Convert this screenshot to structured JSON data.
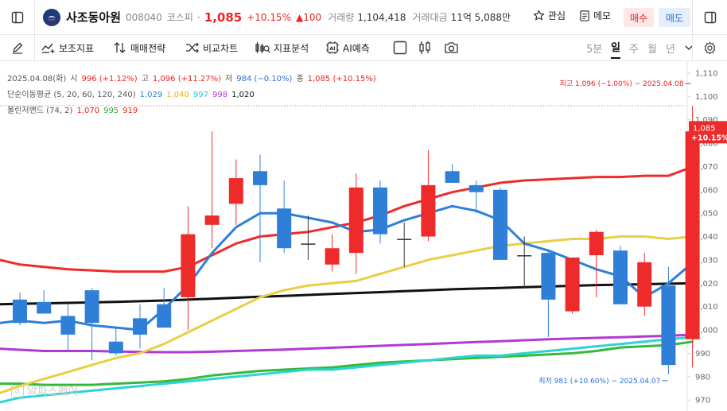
{
  "header": {
    "stock_name": "사조동아원",
    "stock_code": "008040",
    "market": "코스피",
    "price": "1,085",
    "change_pct": "+10.15%",
    "change_abs": "▲100",
    "volume_label": "거래량",
    "volume_value": "1,104,418",
    "amount_label": "거래대금",
    "amount_value": "11억 5,088만",
    "watch_label": "관심",
    "memo_label": "메모",
    "buy_label": "매수",
    "sell_label": "매도"
  },
  "toolbar": {
    "indicators_label": "보조지표",
    "strategy_label": "매매전략",
    "compare_label": "비교차트",
    "analysis_label": "지표분석",
    "ai_label": "AI예측",
    "periods": [
      "5분",
      "일",
      "주",
      "월",
      "년"
    ],
    "active_period": "일"
  },
  "info": {
    "date": "2025.04.08(화)",
    "open_label": "시",
    "open_value": "996 (+1.12%)",
    "high_label": "고",
    "high_value": "1,096 (+11.27%)",
    "low_label": "저",
    "low_value": "984 (−0.10%)",
    "close_label": "종",
    "close_value": "1,085 (+10.15%)",
    "ma_label": "단순이동평균 (5, 20, 60, 120, 240)",
    "ma_values": [
      "1,029",
      "1,040",
      "997",
      "998",
      "1,020"
    ],
    "bb_label": "볼린저밴드 (74, 2)",
    "bb_values": [
      "1,070",
      "995",
      "919"
    ]
  },
  "colors": {
    "up": "#ee2b2b",
    "down": "#2f7fd8",
    "ma5": "#2f7fd8",
    "ma20": "#e8cf45",
    "ma60": "#2ed3d8",
    "ma120": "#b03ad6",
    "ma240": "#111111",
    "bb_upper": "#ee2b2b",
    "bb_mid": "#36b83a"
  },
  "watermark": "알파스퀘어",
  "chart_data": {
    "type": "candlestick",
    "ylim": [
      967,
      1112
    ],
    "yticks": [
      970,
      980,
      990,
      1000,
      1010,
      1020,
      1030,
      1040,
      1050,
      1060,
      1070,
      1080,
      1090,
      1100,
      1110
    ],
    "price_badge": [
      "1,085",
      "+10.15%"
    ],
    "candles": [
      {
        "o": 1013,
        "h": 1016,
        "l": 1002,
        "c": 1003
      },
      {
        "o": 1012,
        "h": 1017,
        "l": 1007,
        "c": 1007
      },
      {
        "o": 1006,
        "h": 1011,
        "l": 991,
        "c": 998
      },
      {
        "o": 1017,
        "h": 1018,
        "l": 987,
        "c": 1003
      },
      {
        "o": 995,
        "h": 1001,
        "l": 989,
        "c": 990
      },
      {
        "o": 1005,
        "h": 1011,
        "l": 992,
        "c": 998
      },
      {
        "o": 1011,
        "h": 1018,
        "l": 1001,
        "c": 1001
      },
      {
        "o": 1014,
        "h": 1053,
        "l": 1000,
        "c": 1041
      },
      {
        "o": 1045,
        "h": 1085,
        "l": 1035,
        "c": 1049
      },
      {
        "o": 1054,
        "h": 1073,
        "l": 1045,
        "c": 1065
      },
      {
        "o": 1068,
        "h": 1075,
        "l": 1029,
        "c": 1062
      },
      {
        "o": 1052,
        "h": 1064,
        "l": 1033,
        "c": 1035
      },
      {
        "o": 1037,
        "h": 1049,
        "l": 1030,
        "c": 1037
      },
      {
        "o": 1028,
        "h": 1041,
        "l": 1025,
        "c": 1035
      },
      {
        "o": 1033,
        "h": 1067,
        "l": 1024,
        "c": 1061
      },
      {
        "o": 1061,
        "h": 1064,
        "l": 1037,
        "c": 1041
      },
      {
        "o": 1039,
        "h": 1046,
        "l": 1027,
        "c": 1039
      },
      {
        "o": 1040,
        "h": 1077,
        "l": 1038,
        "c": 1062
      },
      {
        "o": 1068,
        "h": 1071,
        "l": 1063,
        "c": 1063
      },
      {
        "o": 1062,
        "h": 1064,
        "l": 1050,
        "c": 1059
      },
      {
        "o": 1060,
        "h": 1061,
        "l": 1030,
        "c": 1030
      },
      {
        "o": 1032,
        "h": 1040,
        "l": 1018,
        "c": 1032
      },
      {
        "o": 1033,
        "h": 1034,
        "l": 997,
        "c": 1013
      },
      {
        "o": 1008,
        "h": 1031,
        "l": 1007,
        "c": 1031
      },
      {
        "o": 1032,
        "h": 1043,
        "l": 1014,
        "c": 1042
      },
      {
        "o": 1034,
        "h": 1036,
        "l": 1011,
        "c": 1011
      },
      {
        "o": 1010,
        "h": 1033,
        "l": 1006,
        "c": 1029
      },
      {
        "o": 1019,
        "h": 1027,
        "l": 981,
        "c": 985
      },
      {
        "o": 996,
        "h": 1096,
        "l": 984,
        "c": 1085
      }
    ],
    "ma5": [
      1003,
      1004,
      1003,
      1004,
      1002,
      1001,
      1000,
      1009,
      1019,
      1033,
      1044,
      1050,
      1050,
      1048,
      1046,
      1042,
      1043,
      1047,
      1050,
      1053,
      1051,
      1047,
      1037,
      1034,
      1030,
      1026,
      1023,
      1014,
      1020,
      1029
    ],
    "ma20": [
      973,
      976,
      979,
      982,
      985,
      988,
      990,
      994,
      999,
      1004,
      1009,
      1014,
      1017,
      1019,
      1020,
      1021,
      1024,
      1027,
      1030,
      1032,
      1034,
      1036,
      1037,
      1038,
      1039,
      1039,
      1040,
      1040,
      1039,
      1040
    ],
    "ma60": [
      969,
      971,
      972,
      973,
      974,
      975,
      976,
      977,
      978,
      979,
      980,
      981,
      982,
      983,
      983,
      984,
      985,
      986,
      987,
      988,
      989,
      989,
      990,
      991,
      992,
      993,
      994,
      995,
      996,
      997
    ],
    "ma120": [
      992,
      991.5,
      991,
      991,
      991,
      990.8,
      990.6,
      990.5,
      990.5,
      990.7,
      991,
      991.3,
      991.6,
      992,
      992.4,
      992.8,
      993.2,
      993.6,
      994,
      994.4,
      994.8,
      995.2,
      995.6,
      996,
      996.3,
      996.6,
      996.9,
      997.2,
      997.5,
      998
    ],
    "ma240": [
      1011,
      1011.2,
      1011.4,
      1011.6,
      1011.8,
      1012,
      1012.3,
      1012.6,
      1013,
      1013.4,
      1013.8,
      1014.2,
      1014.6,
      1015,
      1015.4,
      1015.8,
      1016.2,
      1016.6,
      1017,
      1017.4,
      1017.7,
      1018,
      1018.3,
      1018.6,
      1018.9,
      1019.2,
      1019.4,
      1019.6,
      1019.8,
      1020
    ],
    "bb_upper": [
      1030,
      1028,
      1027,
      1026,
      1025.5,
      1025,
      1025,
      1025,
      1027,
      1032,
      1037,
      1040,
      1041,
      1042,
      1044,
      1046,
      1049,
      1053,
      1056,
      1059,
      1061,
      1063,
      1064,
      1064.5,
      1065,
      1065.5,
      1065.5,
      1066,
      1066,
      1070
    ],
    "bb_mid": [
      977,
      977,
      976.5,
      976.5,
      976.5,
      977,
      977.5,
      978,
      979,
      980.5,
      981.5,
      982.5,
      983,
      983.5,
      984,
      985,
      986,
      986.5,
      987,
      987.5,
      988,
      988.5,
      989,
      989.5,
      990,
      991,
      992.5,
      993,
      993.5,
      995
    ],
    "high_annotation": "최고 1,096 (−1.00%) − 2025.04.08",
    "low_annotation": "최저 981 (+10.60%) − 2025.04.07"
  }
}
